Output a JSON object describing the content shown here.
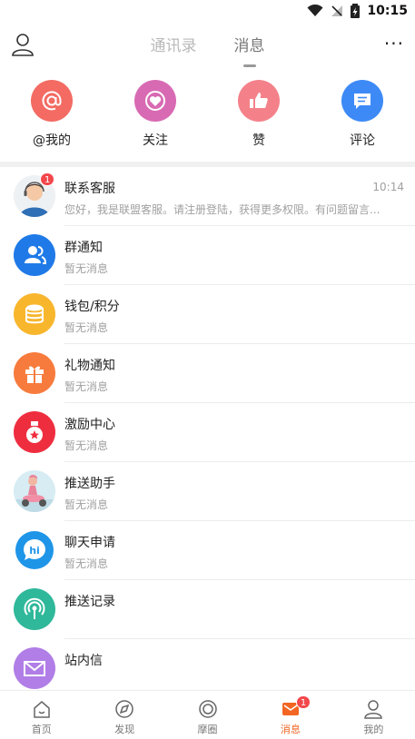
{
  "status_bar": {
    "time": "10:15"
  },
  "header": {
    "tabs": [
      {
        "label": "通讯录",
        "active": false
      },
      {
        "label": "消息",
        "active": true
      }
    ],
    "more": "···"
  },
  "quick_actions": [
    {
      "label": "@我的",
      "icon": "at-icon",
      "color": "#f36b63"
    },
    {
      "label": "关注",
      "icon": "heart-icon",
      "color": "#d86ab3"
    },
    {
      "label": "赞",
      "icon": "thumbs-up-icon",
      "color": "#f4818a"
    },
    {
      "label": "评论",
      "icon": "comment-icon",
      "color": "#3d8af7"
    }
  ],
  "messages": [
    {
      "name": "联系客服",
      "preview": "您好，我是联盟客服。请注册登陆，获得更多权限。有问题留言...",
      "time": "10:14",
      "badge": "1",
      "icon": "customer-service-avatar"
    },
    {
      "name": "群通知",
      "preview": "暂无消息",
      "icon": "group-icon",
      "color": "#1f7ae8"
    },
    {
      "name": "钱包/积分",
      "preview": "暂无消息",
      "icon": "coins-icon",
      "color": "#f8b62d"
    },
    {
      "name": "礼物通知",
      "preview": "暂无消息",
      "icon": "gift-icon",
      "color": "#f77b3d"
    },
    {
      "name": "激励中心",
      "preview": "暂无消息",
      "icon": "reward-icon",
      "color": "#ee2e3f"
    },
    {
      "name": "推送助手",
      "preview": "暂无消息",
      "icon": "push-assistant-avatar"
    },
    {
      "name": "聊天申请",
      "preview": "暂无消息",
      "icon": "hi-icon",
      "color": "#1f95e8"
    },
    {
      "name": "推送记录",
      "preview": "",
      "icon": "broadcast-icon",
      "color": "#2fb89a"
    },
    {
      "name": "站内信",
      "preview": "",
      "icon": "mail-icon",
      "color": "#b07ee6"
    }
  ],
  "bottom_nav": [
    {
      "label": "首页",
      "icon": "home-icon",
      "active": false
    },
    {
      "label": "发现",
      "icon": "discover-icon",
      "active": false
    },
    {
      "label": "摩圈",
      "icon": "circle-icon",
      "active": false
    },
    {
      "label": "消息",
      "icon": "message-icon",
      "active": true,
      "badge": "1"
    },
    {
      "label": "我的",
      "icon": "profile-icon",
      "active": false
    }
  ],
  "colors": {
    "accent": "#f26522",
    "badge": "#f2474b"
  }
}
